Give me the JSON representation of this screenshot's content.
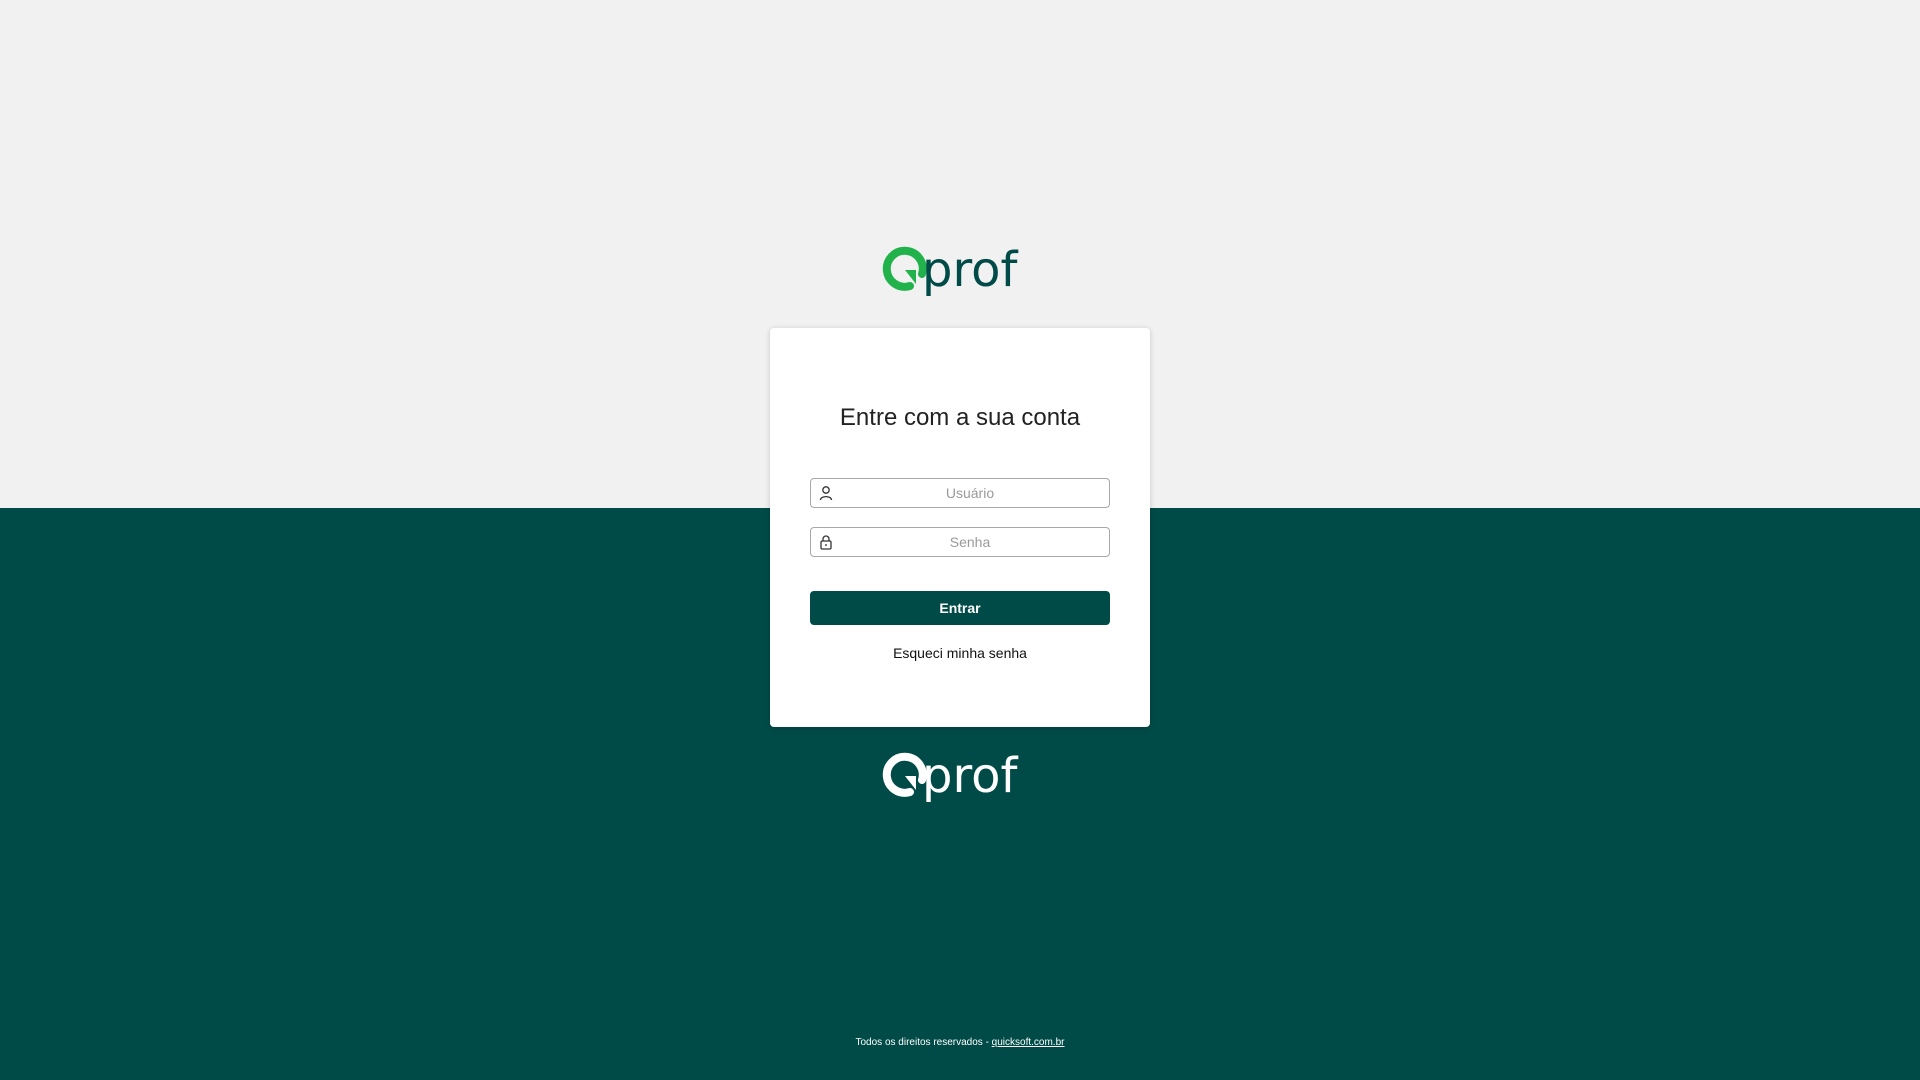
{
  "brand": {
    "name": "Qprof",
    "logo_text": "prof",
    "colors": {
      "dark_teal": "#004b47",
      "bright_green": "#22b24c",
      "light_bg": "#f1f1f1"
    }
  },
  "login": {
    "title": "Entre com a sua conta",
    "username": {
      "placeholder": "Usuário",
      "value": "",
      "icon": "user-icon"
    },
    "password": {
      "placeholder": "Senha",
      "value": "",
      "icon": "lock-icon"
    },
    "submit_label": "Entrar",
    "forgot_label": "Esqueci minha senha"
  },
  "footer": {
    "text": "Todos os direitos reservados - ",
    "link_label": "quicksoft.com.br"
  }
}
